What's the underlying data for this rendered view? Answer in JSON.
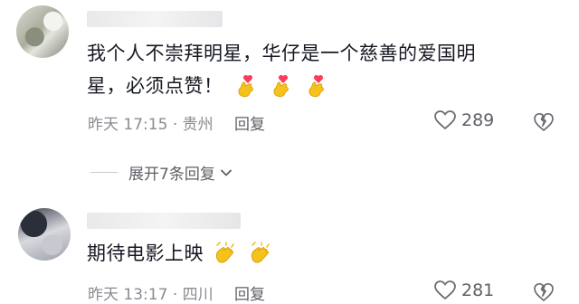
{
  "comments": [
    {
      "text_line1": "我个人不崇拜明星，华仔是一个慈善的爱国明",
      "text_line2": "星，必须点赞！",
      "time": "昨天 17:15",
      "location": "贵州",
      "reply_label": "回复",
      "likes": "289",
      "emoji": [
        "finger-heart-emoji",
        "finger-heart-emoji",
        "finger-heart-emoji"
      ]
    },
    {
      "text_line1": "期待电影上映",
      "time": "昨天 13:17",
      "location": "四川",
      "reply_label": "回复",
      "likes": "281",
      "emoji": [
        "clapping-hands-emoji",
        "clapping-hands-emoji"
      ]
    }
  ],
  "expand_replies": {
    "label": "展开7条回复"
  },
  "colors": {
    "text": "#161823",
    "meta": "#8a8b91",
    "accent_heart": "#ff3b5c",
    "emoji_yellow": "#f5c21b"
  }
}
